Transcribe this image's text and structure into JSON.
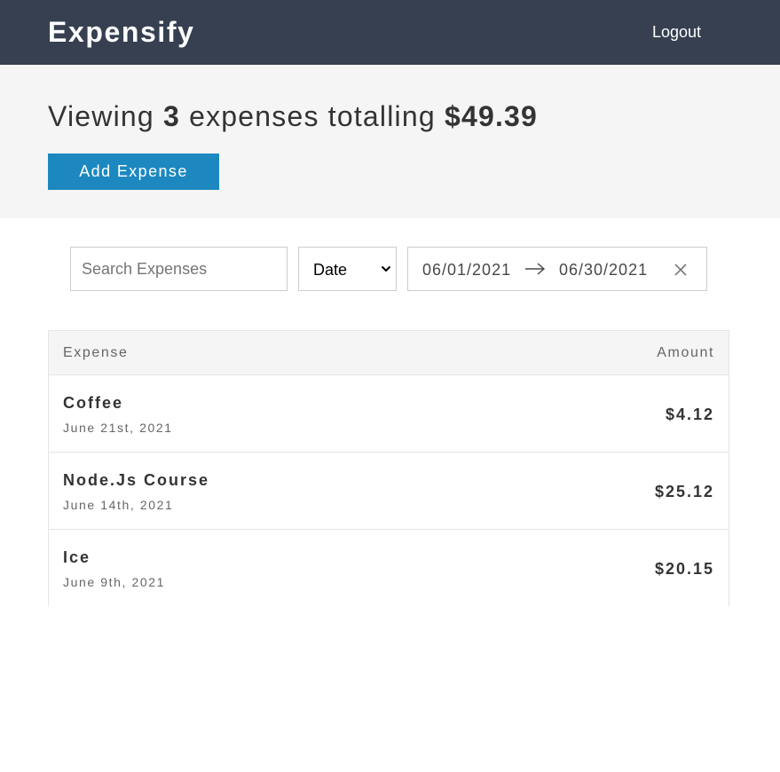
{
  "header": {
    "brand": "Expensify",
    "logout_label": "Logout"
  },
  "summary": {
    "prefix": "Viewing",
    "count": "3",
    "middle": "expenses totalling",
    "total": "$49.39",
    "add_button_label": "Add Expense"
  },
  "filters": {
    "search_placeholder": "Search Expenses",
    "search_value": "",
    "sort_by": "Date",
    "start_date": "06/01/2021",
    "end_date": "06/30/2021"
  },
  "table": {
    "headers": [
      "Expense",
      "Amount"
    ],
    "rows": [
      {
        "description": "Coffee",
        "date": "June 21st, 2021",
        "amount": "$4.12"
      },
      {
        "description": "Node.Js Course",
        "date": "June 14th, 2021",
        "amount": "$25.12"
      },
      {
        "description": "Ice",
        "date": "June 9th, 2021",
        "amount": "$20.15"
      }
    ]
  },
  "colors": {
    "header_bg": "#364051",
    "summary_bg": "#f5f5f5",
    "accent": "#1c88bf"
  },
  "icons": {
    "sort_chevron": "chevron-down-icon",
    "date_arrow": "arrow-right-icon",
    "date_clear": "close-icon"
  }
}
